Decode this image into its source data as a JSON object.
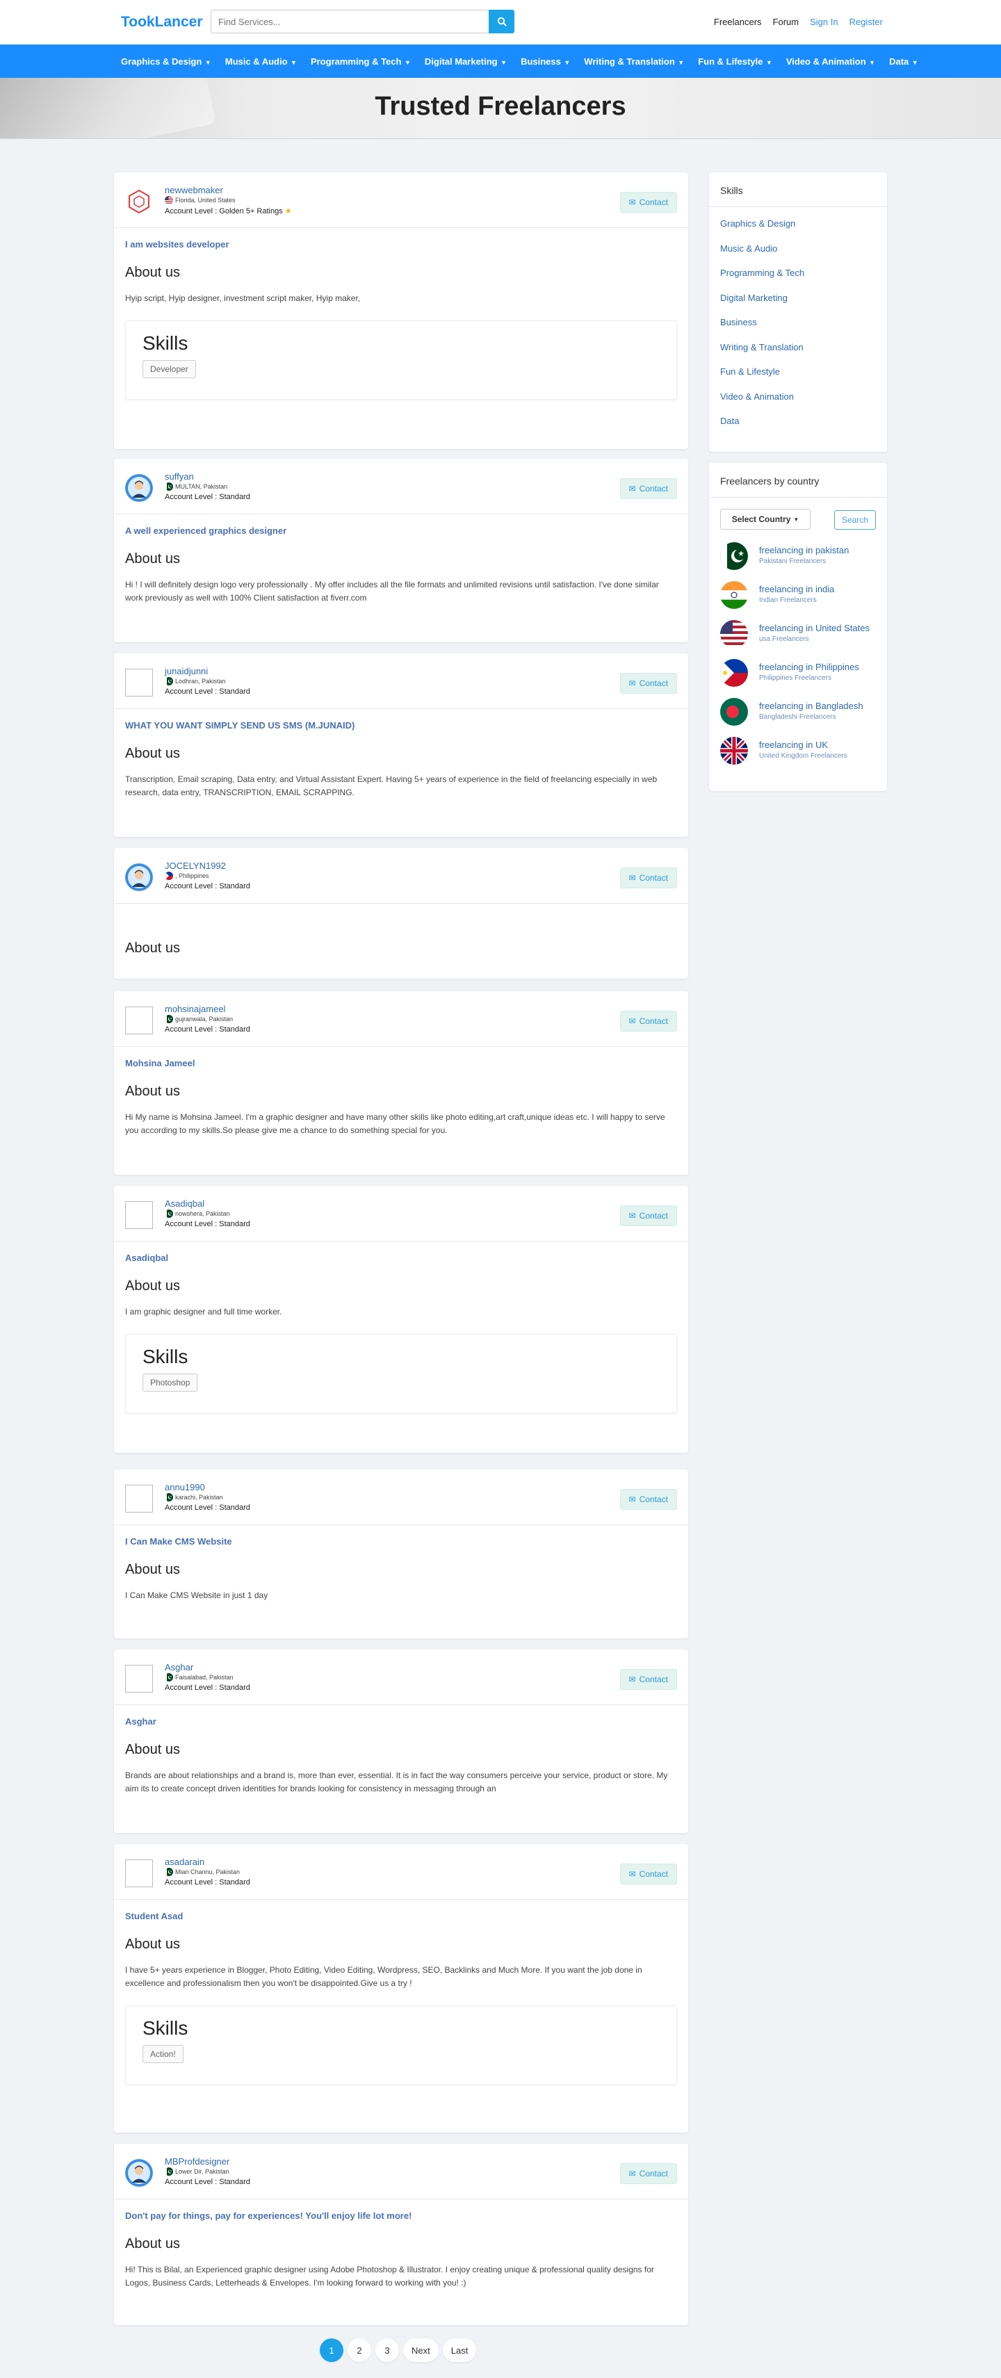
{
  "header": {
    "logo": "TookLancer",
    "search_placeholder": "Find Services...",
    "links": [
      "Freelancers",
      "Forum",
      "Sign In",
      "Register"
    ]
  },
  "nav": [
    "Graphics & Design",
    "Music & Audio",
    "Programming & Tech",
    "Digital Marketing",
    "Business",
    "Writing & Translation",
    "Fun & Lifestyle",
    "Video & Animation",
    "Data"
  ],
  "hero": {
    "title": "Trusted Freelancers"
  },
  "freelancers": [
    {
      "username": "newwebmaker",
      "location": "Florida, United States",
      "level": "Account Level : Golden",
      "ratings": "5+ Ratings",
      "avatar": "hex-logo",
      "flag": "us",
      "tagline": "I am websites developer",
      "about_heading": "About us",
      "about": "Hyip script, Hyip designer, investment script maker, Hyip maker,",
      "skills_heading": "Skills",
      "skills": [
        "Developer"
      ]
    },
    {
      "username": "suffyan",
      "location": "MULTAN, Pakistan",
      "level": "Account Level : Standard",
      "avatar": "person",
      "flag": "pk",
      "tagline": "A well experienced graphics designer",
      "about_heading": "About us",
      "about": "Hi ! I will  definitely design logo very professionally . My offer includes all the file formats and unlimited revisions until satisfaction. I've done similar work previously as well with 100% Client satisfaction at fiverr.com"
    },
    {
      "username": "junaidjunni",
      "location": "Lodhran, Pakistan",
      "level": "Account Level : Standard",
      "avatar": "broken",
      "flag": "pk",
      "tagline": "WHAT YOU WANT SIMPLY SEND US SMS (M.JUNAID)",
      "about_heading": "About us",
      "about": "Transcription, Email scraping, Data entry, and Virtual Assistant Expert. Having 5+ years of experience in the field of freelancing especially in web research, data entry, TRANSCRIPTION, EMAIL SCRAPPING."
    },
    {
      "username": "JOCELYN1992",
      "location": ", Philippines",
      "level": "Account Level : Standard",
      "avatar": "person",
      "flag": "ph",
      "tagline": "",
      "about_heading": "About us",
      "about": ""
    },
    {
      "username": "mohsinajameel",
      "location": "gujranwala, Pakistan",
      "level": "Account Level : Standard",
      "avatar": "broken",
      "flag": "pk",
      "tagline": "Mohsina Jameel",
      "about_heading": "About us",
      "about": "Hi My name is Mohsina Jameel. I'm a graphic designer and have many other skills like photo editing,art craft,unique ideas etc. I will happy to serve you according to my skills.So please give me a chance to do something special for you."
    },
    {
      "username": "Asadiqbal",
      "location": "nowshera, Pakistan",
      "level": "Account Level : Standard",
      "avatar": "broken",
      "flag": "pk",
      "tagline": "Asadiqbal",
      "about_heading": "About us",
      "about": "I am graphic designer and full time worker.",
      "skills_heading": "Skills",
      "skills": [
        "Photoshop"
      ]
    },
    {
      "username": "annu1990",
      "location": "karachi, Pakistan",
      "level": "Account Level : Standard",
      "avatar": "broken",
      "flag": "pk",
      "tagline": "I Can Make CMS Website",
      "about_heading": "About us",
      "about": "I Can Make CMS Website in just 1 day"
    },
    {
      "username": "Asghar",
      "location": "Faisalabad, Pakistan",
      "level": "Account Level : Standard",
      "avatar": "broken",
      "flag": "pk",
      "tagline": "Asghar",
      "about_heading": "About us",
      "about": "Brands are about relationships and a brand is, more than ever, essential. It is in fact the way consumers perceive your service, product or store. My aim its to create concept driven identities for brands looking for consistency in messaging through an"
    },
    {
      "username": "asadarain",
      "location": "Mian Channu, Pakistan",
      "level": "Account Level : Standard",
      "avatar": "broken",
      "flag": "pk",
      "tagline": "Student Asad",
      "about_heading": "About us",
      "about": "I have 5+ years experience in Blogger, Photo Editing, Video Editing, Wordpress, SEO, Backlinks and Much More. If you want the job done in excellence and professionalism then you won't be disappointed.Give us a try !",
      "skills_heading": "Skills",
      "skills": [
        "Action!"
      ]
    },
    {
      "username": "MBProfdesigner",
      "location": "Lower Dir, Pakistan",
      "level": "Account Level : Standard",
      "avatar": "person",
      "flag": "pk",
      "tagline": "Don't pay for things, pay for experiences! You'll enjoy life lot more!",
      "about_heading": "About us",
      "about": "Hi! This is Bilal, an Experienced graphic designer using Adobe Photoshop & Illustrator. I enjoy creating unique & professional quality designs for Logos, Business Cards, Letterheads & Envelopes. I'm looking forward to working with you! :)"
    }
  ],
  "contact_label": "Contact",
  "sidebar": {
    "skills_title": "Skills",
    "skills": [
      "Graphics & Design",
      "Music & Audio",
      "Programming & Tech",
      "Digital Marketing",
      "Business",
      "Writing & Translation",
      "Fun & Lifestyle",
      "Video & Animation",
      "Data"
    ],
    "country_title": "Freelancers by country",
    "select_label": "Select Country",
    "search_label": "Search",
    "countries": [
      {
        "title": "freelancing in pakistan",
        "sub": "Pakistani Freelancers",
        "flag": "pk"
      },
      {
        "title": "freelancing in india",
        "sub": "Indian Freelancers",
        "flag": "in"
      },
      {
        "title": "freelancing in United States",
        "sub": "usa Freelancers",
        "flag": "us"
      },
      {
        "title": "freelancing in Philippines",
        "sub": "Philippines Freelancers",
        "flag": "ph"
      },
      {
        "title": "freelancing in Bangladesh",
        "sub": "Bangladeshi Freelancers",
        "flag": "bd"
      },
      {
        "title": "freelancing in UK",
        "sub": "United Kingdom Freelancers",
        "flag": "uk"
      }
    ]
  },
  "pagination": [
    "1",
    "2",
    "3",
    "Next",
    "Last"
  ],
  "colors": {
    "brand": "#1a8cff",
    "link": "#2e6aa8",
    "accent": "#1aa3e8",
    "star": "#f5b301"
  }
}
